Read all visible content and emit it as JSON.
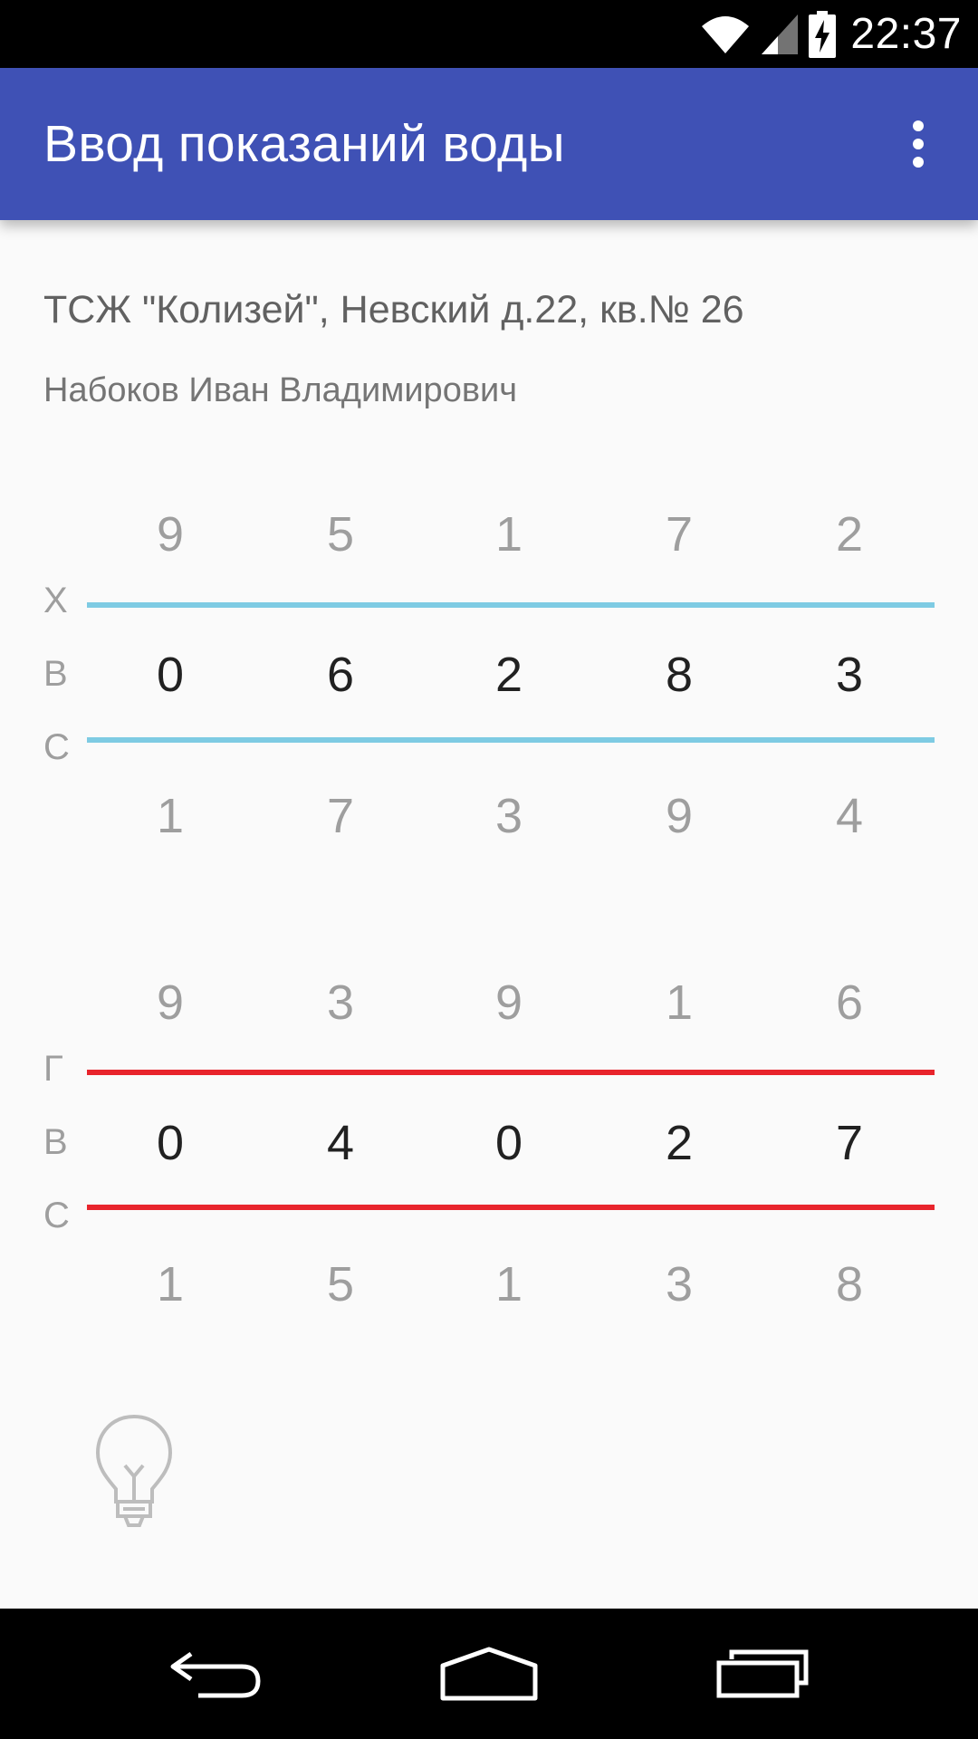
{
  "status_bar": {
    "time": "22:37",
    "icons": [
      "wifi-icon",
      "signal-icon",
      "battery-charging-icon"
    ]
  },
  "app_bar": {
    "title": "Ввод показаний воды",
    "menu_icon": "more-vert-icon",
    "color": "#3f51b5"
  },
  "info": {
    "address": "ТСЖ \"Колизей\", Невский д.22, кв.№ 26",
    "owner": "Набоков Иван Владимирович"
  },
  "meters": [
    {
      "label_letters": [
        "Х",
        "В",
        "С"
      ],
      "line_color": "#7ecbe3",
      "above": [
        "9",
        "5",
        "1",
        "7",
        "2"
      ],
      "current": [
        "0",
        "6",
        "2",
        "8",
        "3"
      ],
      "below": [
        "1",
        "7",
        "3",
        "9",
        "4"
      ]
    },
    {
      "label_letters": [
        "Г",
        "В",
        "С"
      ],
      "line_color": "#e8242c",
      "above": [
        "9",
        "3",
        "9",
        "1",
        "6"
      ],
      "current": [
        "0",
        "4",
        "0",
        "2",
        "7"
      ],
      "below": [
        "1",
        "5",
        "1",
        "3",
        "8"
      ]
    }
  ],
  "hint_icon": "lightbulb-icon",
  "nav_bar": {
    "icons": [
      "back-icon",
      "home-icon",
      "recents-icon"
    ]
  }
}
